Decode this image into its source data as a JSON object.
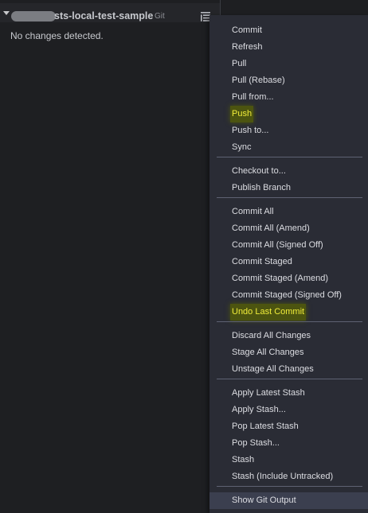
{
  "scm": {
    "repo_name": "sts-local-test-sample",
    "provider": "Git",
    "status": "No changes detected."
  },
  "menu": {
    "groups": [
      {
        "items": [
          {
            "label": "Commit"
          },
          {
            "label": "Refresh"
          },
          {
            "label": "Pull"
          },
          {
            "label": "Pull (Rebase)"
          },
          {
            "label": "Pull from..."
          },
          {
            "label": "Push",
            "highlighted": true
          },
          {
            "label": "Push to..."
          },
          {
            "label": "Sync"
          }
        ]
      },
      {
        "items": [
          {
            "label": "Checkout to..."
          },
          {
            "label": "Publish Branch"
          }
        ]
      },
      {
        "items": [
          {
            "label": "Commit All"
          },
          {
            "label": "Commit All (Amend)"
          },
          {
            "label": "Commit All (Signed Off)"
          },
          {
            "label": "Commit Staged"
          },
          {
            "label": "Commit Staged (Amend)"
          },
          {
            "label": "Commit Staged (Signed Off)"
          },
          {
            "label": "Undo Last Commit",
            "highlighted": true
          }
        ]
      },
      {
        "items": [
          {
            "label": "Discard All Changes"
          },
          {
            "label": "Stage All Changes"
          },
          {
            "label": "Unstage All Changes"
          }
        ]
      },
      {
        "items": [
          {
            "label": "Apply Latest Stash"
          },
          {
            "label": "Apply Stash..."
          },
          {
            "label": "Pop Latest Stash"
          },
          {
            "label": "Pop Stash..."
          },
          {
            "label": "Stash"
          },
          {
            "label": "Stash (Include Untracked)"
          }
        ]
      },
      {
        "items": [
          {
            "label": "Show Git Output",
            "hovered": true
          }
        ]
      }
    ]
  },
  "colors": {
    "highlight_text": "#f0ec3a",
    "highlight_bg": "#4c5410",
    "menu_bg": "#2a2c35",
    "panel_bg": "#1e1f22"
  }
}
